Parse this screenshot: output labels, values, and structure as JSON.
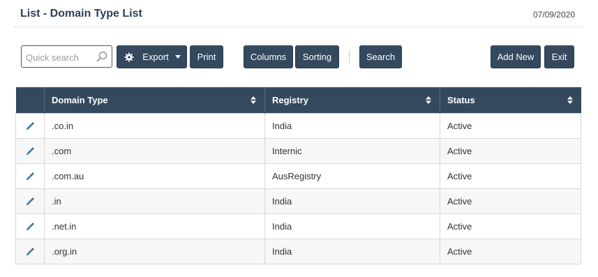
{
  "header": {
    "title": "List - Domain Type List",
    "date": "07/09/2020"
  },
  "toolbar": {
    "search_placeholder": "Quick search",
    "export_label": "Export",
    "print_label": "Print",
    "columns_label": "Columns",
    "sorting_label": "Sorting",
    "search_label": "Search",
    "add_new_label": "Add New",
    "exit_label": "Exit"
  },
  "table": {
    "columns": [
      "Domain Type",
      "Registry",
      "Status"
    ],
    "rows": [
      {
        "domain_type": ".co.in",
        "registry": "India",
        "status": "Active"
      },
      {
        "domain_type": ".com",
        "registry": "Internic",
        "status": "Active"
      },
      {
        "domain_type": ".com.au",
        "registry": "AusRegistry",
        "status": "Active"
      },
      {
        "domain_type": ".in",
        "registry": "India",
        "status": "Active"
      },
      {
        "domain_type": ".net.in",
        "registry": "India",
        "status": "Active"
      },
      {
        "domain_type": ".org.in",
        "registry": "India",
        "status": "Active"
      }
    ]
  },
  "icons": {
    "row_action": "pencil-icon",
    "export": "gear-icon",
    "search": "magnifier-icon",
    "sort": "sort-icon"
  },
  "colors": {
    "header_bg": "#34495e",
    "button_bg": "#34495e",
    "title_text": "#2f3f55",
    "pencil": "#4a7fa8"
  }
}
